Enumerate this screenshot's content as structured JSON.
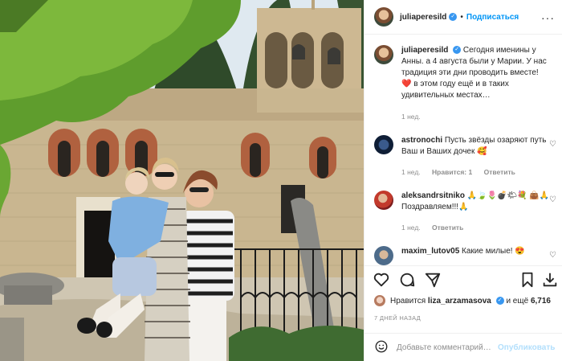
{
  "post": {
    "author": "juliaperesild",
    "follow_label": "Подписаться",
    "more_icon": "more-horizontal-icon",
    "caption_author": "juliaperesild",
    "caption_text": "Сегодня именины у Анны. а 4 августа были у Марии. У нас традиция эти дни проводить вместе! ❤️ в этом году ещё и в таких удивительных местах…",
    "caption_time": "1 нед."
  },
  "comments": [
    {
      "user": "astronochi",
      "text": "Пусть звёзды озаряют путь Ваш и Ваших дочек 🥰",
      "time": "1 нед.",
      "likes": "Нравится: 1",
      "reply": "Ответить"
    },
    {
      "user": "aleksandrsitniko",
      "text": "🙏🍃🌷💣🌤💐 👜🙏Поздравляем!!!🙏",
      "time": "1 нед.",
      "likes": "",
      "reply": "Ответить"
    },
    {
      "user": "maxim_lutov05",
      "text": "Какие милые! 😍",
      "time": "",
      "likes": "",
      "reply": ""
    }
  ],
  "actions": {
    "like_icon": "heart-icon",
    "comment_icon": "comment-icon",
    "share_icon": "send-icon",
    "save_icon": "bookmark-icon",
    "download_icon": "download-icon"
  },
  "likes": {
    "prefix": "Нравится",
    "user": "liza_arzamasova",
    "suffix": "и ещё",
    "count": "6,716"
  },
  "date_label": "7 ДНЕЙ НАЗАД",
  "comment_box": {
    "placeholder": "Добавьте комментарий…",
    "publish_label": "Опубликовать",
    "emoji_icon": "smiley-icon"
  },
  "colors": {
    "link": "#0095f6",
    "verified": "#3897f0",
    "heart": "#ed4956",
    "muted": "#8e8e8e"
  }
}
